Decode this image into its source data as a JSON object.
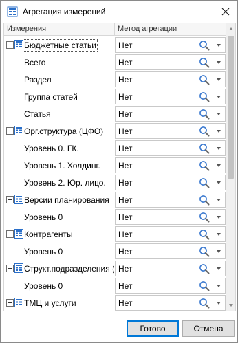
{
  "window": {
    "title": "Агрегация измерений"
  },
  "grid": {
    "columns": [
      "Измерения",
      "Метод агрегации"
    ],
    "rows": [
      {
        "name": "Бюджетные статьи",
        "type": "group",
        "value": "Нет",
        "selected": true
      },
      {
        "name": "Всего",
        "type": "child",
        "value": "Нет"
      },
      {
        "name": "Раздел",
        "type": "child",
        "value": "Нет"
      },
      {
        "name": "Группа статей",
        "type": "child",
        "value": "Нет"
      },
      {
        "name": "Статья",
        "type": "child",
        "value": "Нет"
      },
      {
        "name": "Орг.структура (ЦФО)",
        "type": "group",
        "value": "Нет"
      },
      {
        "name": "Уровень 0. ГК.",
        "type": "child",
        "value": "Нет"
      },
      {
        "name": "Уровень 1. Холдинг.",
        "type": "child",
        "value": "Нет"
      },
      {
        "name": "Уровень 2. Юр. лицо.",
        "type": "child",
        "value": "Нет"
      },
      {
        "name": "Версии планирования",
        "type": "group",
        "value": "Нет"
      },
      {
        "name": "Уровень 0",
        "type": "child",
        "value": "Нет"
      },
      {
        "name": "Контрагенты",
        "type": "group",
        "value": "Нет"
      },
      {
        "name": "Уровень 0",
        "type": "child",
        "value": "Нет"
      },
      {
        "name": "Структ.подразделения (Г",
        "type": "group",
        "value": "Нет"
      },
      {
        "name": "Уровень 0",
        "type": "child",
        "value": "Нет"
      },
      {
        "name": "ТМЦ и услуги",
        "type": "group",
        "value": "Нет"
      },
      {
        "name": "",
        "type": "child",
        "value": ""
      }
    ]
  },
  "buttons": {
    "ok": "Готово",
    "cancel": "Отмена"
  },
  "colors": {
    "accent": "#0078d7",
    "dimension_icon": "#2a6fc9"
  },
  "icons": {
    "app": "dimension-aggregation-icon",
    "close": "close-icon",
    "search": "search-icon",
    "dropdown": "chevron-down-icon",
    "expander": "collapse-minus-icon",
    "dimension": "dimension-table-icon"
  }
}
